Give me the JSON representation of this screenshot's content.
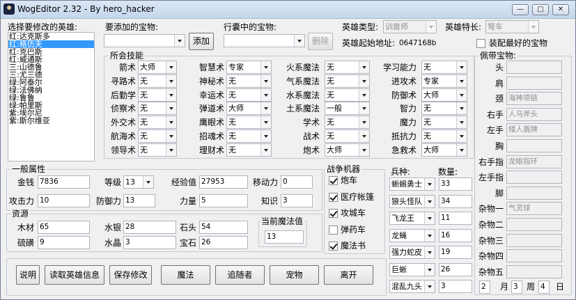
{
  "window": {
    "title": "WogEditor 2.32 - By  hero_hacker",
    "minimize": "—",
    "restore": "□",
    "close": "✕"
  },
  "heroes": {
    "label": "选择要修改的英雄:",
    "items": [
      "红:达克斯多",
      "红:格仿夫",
      "红:克巴斯",
      "红:威通斯",
      "三:山德鲁",
      "三:尤三德",
      "绿:阿泰尔",
      "绿:法佛纳",
      "绿:鲁鲁",
      "绿:帕里斯",
      "紫:埃尔尼",
      "紫:斯尔维亚"
    ],
    "selected_index": 1
  },
  "top": {
    "add_artifact_label": "要添加的宝物:",
    "add_button": "添加",
    "bag_label": "行囊中的宝物:",
    "delete_button": "删除",
    "hero_type_label": "英雄类型:",
    "hero_type_value": "训兽师",
    "hero_specialty_label": "英雄特长:",
    "hero_specialty_value": "弩车",
    "start_address_label": "英雄起始地址:",
    "start_address_value": "0647168b",
    "best_artifact_label": "装配最好的宝物",
    "best_artifact_checked": false
  },
  "skills": {
    "title": "所会技能",
    "items": [
      {
        "label": "箭术",
        "value": "大师"
      },
      {
        "label": "寻路术",
        "value": "无"
      },
      {
        "label": "后勤学",
        "value": "无"
      },
      {
        "label": "侦察术",
        "value": "无"
      },
      {
        "label": "外交术",
        "value": "无"
      },
      {
        "label": "航海术",
        "value": "无"
      },
      {
        "label": "领导术",
        "value": "无"
      },
      {
        "label": "智慧术",
        "value": "专家"
      },
      {
        "label": "神秘术",
        "value": "无"
      },
      {
        "label": "幸运术",
        "value": "无"
      },
      {
        "label": "弹道术",
        "value": "大师"
      },
      {
        "label": "鹰眼术",
        "value": "无"
      },
      {
        "label": "招魂术",
        "value": "无"
      },
      {
        "label": "理财术",
        "value": "无"
      },
      {
        "label": "火系魔法",
        "value": "无"
      },
      {
        "label": "气系魔法",
        "value": "无"
      },
      {
        "label": "水系魔法",
        "value": "无"
      },
      {
        "label": "土系魔法",
        "value": "一般"
      },
      {
        "label": "学术",
        "value": "无"
      },
      {
        "label": "战术",
        "value": "无"
      },
      {
        "label": "炮术",
        "value": "大师"
      },
      {
        "label": "学习能力",
        "value": "无"
      },
      {
        "label": "进攻术",
        "value": "专家"
      },
      {
        "label": "防御术",
        "value": "大师"
      },
      {
        "label": "智力",
        "value": "无"
      },
      {
        "label": "魔力",
        "value": "无"
      },
      {
        "label": "抵抗力",
        "value": "无"
      },
      {
        "label": "急救术",
        "value": "大师"
      }
    ]
  },
  "general": {
    "title": "一般属性",
    "gold_label": "金钱",
    "gold": "7836",
    "level_label": "等级",
    "level": "13",
    "exp_label": "经验值",
    "exp": "27953",
    "move_label": "移动力",
    "move": "0",
    "attack_label": "攻击力",
    "attack": "10",
    "defense_label": "防御力",
    "defense": "13",
    "power_label": "力量",
    "power": "5",
    "knowledge_label": "知识",
    "knowledge": "3"
  },
  "resources": {
    "title": "资源",
    "wood_label": "木材",
    "wood": "65",
    "mercury_label": "水银",
    "mercury": "28",
    "ore_label": "石头",
    "ore": "54",
    "sulfur_label": "硫磺",
    "sulfur": "9",
    "crystal_label": "水晶",
    "crystal": "3",
    "gems_label": "宝石",
    "gems": "26",
    "mana_title": "当前魔法值",
    "mana": "13"
  },
  "machines": {
    "title": "战争机器",
    "items": [
      {
        "label": "炮车",
        "checked": true
      },
      {
        "label": "医疗帐篷",
        "checked": true
      },
      {
        "label": "攻城车",
        "checked": true
      },
      {
        "label": "弹药车",
        "checked": false
      },
      {
        "label": "魔法书",
        "checked": true
      }
    ]
  },
  "troops": {
    "type_label": "兵种:",
    "count_label": "数量:",
    "items": [
      {
        "type": "蜥蜴勇士",
        "count": "33"
      },
      {
        "type": "狼头怪队",
        "count": "34"
      },
      {
        "type": "飞龙王",
        "count": "11"
      },
      {
        "type": "龙蝇",
        "count": "16"
      },
      {
        "type": "强力蛇皮",
        "count": "19"
      },
      {
        "type": "巨蜥",
        "count": "26"
      },
      {
        "type": "混乱九头",
        "count": "3"
      }
    ]
  },
  "buttons": {
    "about": "说明",
    "read": "读取英雄信息",
    "save": "保存修改",
    "magic": "魔法",
    "followers": "追随者",
    "pets": "宠物",
    "leave": "离开"
  },
  "equipped": {
    "title": "佩带宝物:",
    "slots": [
      {
        "label": "头",
        "value": ""
      },
      {
        "label": "肩",
        "value": ""
      },
      {
        "label": "颈",
        "value": "海神项链"
      },
      {
        "label": "右手",
        "value": "人马斧头"
      },
      {
        "label": "左手",
        "value": "矮人盾牌"
      },
      {
        "label": "胸",
        "value": ""
      },
      {
        "label": "右手指",
        "value": "龙眼指环"
      },
      {
        "label": "左手指",
        "value": ""
      },
      {
        "label": "脚",
        "value": ""
      },
      {
        "label": "杂物一",
        "value": "气灵球"
      },
      {
        "label": "杂物二",
        "value": ""
      },
      {
        "label": "杂物三",
        "value": ""
      },
      {
        "label": "杂物四",
        "value": ""
      },
      {
        "label": "杂物五",
        "value": ""
      }
    ]
  },
  "date": {
    "month": "2",
    "month_label": "月",
    "week": "3",
    "week_label": "周",
    "day": "4",
    "day_label": "日"
  }
}
